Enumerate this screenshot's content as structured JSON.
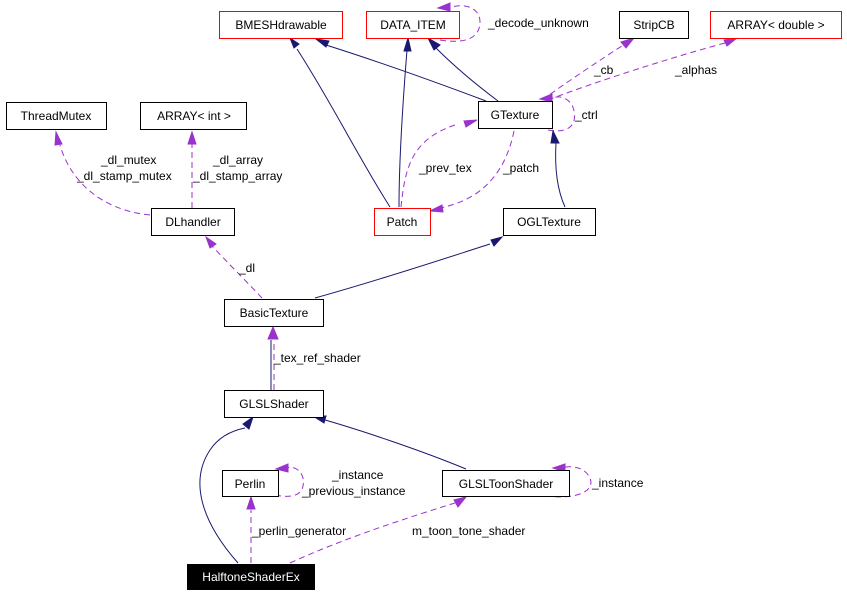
{
  "diagram": {
    "type": "doxygen-collaboration-graph",
    "focus_node": "HalftoneShaderEx",
    "colors": {
      "inheritance_edge": "#191970",
      "usage_edge": "#9a32cd",
      "undocumented_border": "#ff0000",
      "documented_border": "#000000",
      "focus_fill": "#000000"
    },
    "nodes": [
      {
        "id": "bmeshdrawable",
        "label": "BMESHdrawable",
        "style": "red"
      },
      {
        "id": "data_item",
        "label": "DATA_ITEM",
        "style": "red"
      },
      {
        "id": "stripcb",
        "label": "StripCB",
        "style": "normal"
      },
      {
        "id": "array_double",
        "label": "ARRAY< double >",
        "style": "red"
      },
      {
        "id": "threadmutex",
        "label": "ThreadMutex",
        "style": "normal"
      },
      {
        "id": "array_int",
        "label": "ARRAY< int >",
        "style": "normal"
      },
      {
        "id": "gtexture",
        "label": "GTexture",
        "style": "normal"
      },
      {
        "id": "dlhandler",
        "label": "DLhandler",
        "style": "normal"
      },
      {
        "id": "patch",
        "label": "Patch",
        "style": "red"
      },
      {
        "id": "ogltexture",
        "label": "OGLTexture",
        "style": "normal"
      },
      {
        "id": "basictexture",
        "label": "BasicTexture",
        "style": "normal"
      },
      {
        "id": "glslshader",
        "label": "GLSLShader",
        "style": "normal"
      },
      {
        "id": "perlin",
        "label": "Perlin",
        "style": "normal"
      },
      {
        "id": "glsltoonshader",
        "label": "GLSLToonShader",
        "style": "normal"
      },
      {
        "id": "halftoneshaderex",
        "label": "HalftoneShaderEx",
        "style": "focus"
      }
    ],
    "edges": [
      {
        "from": "patch",
        "to": "bmeshdrawable",
        "kind": "inherit",
        "label": ""
      },
      {
        "from": "gtexture",
        "to": "bmeshdrawable",
        "kind": "inherit",
        "label": ""
      },
      {
        "from": "patch",
        "to": "data_item",
        "kind": "inherit",
        "label": ""
      },
      {
        "from": "gtexture",
        "to": "data_item",
        "kind": "inherit",
        "label": ""
      },
      {
        "from": "data_item",
        "to": "data_item",
        "kind": "usage",
        "label": "_decode_unknown"
      },
      {
        "from": "gtexture",
        "to": "stripcb",
        "kind": "usage",
        "label": "_cb"
      },
      {
        "from": "gtexture",
        "to": "array_double",
        "kind": "usage",
        "label": "_alphas"
      },
      {
        "from": "gtexture",
        "to": "gtexture",
        "kind": "usage",
        "label": "_ctrl"
      },
      {
        "from": "patch",
        "to": "gtexture",
        "kind": "usage",
        "label": "_prev_tex"
      },
      {
        "from": "gtexture",
        "to": "patch",
        "kind": "usage",
        "label": "_patch"
      },
      {
        "from": "dlhandler",
        "to": "threadmutex",
        "kind": "usage",
        "label": "_dl_mutex\n_dl_stamp_mutex"
      },
      {
        "from": "dlhandler",
        "to": "array_int",
        "kind": "usage",
        "label": "_dl_array\n_dl_stamp_array"
      },
      {
        "from": "ogltexture",
        "to": "gtexture",
        "kind": "inherit",
        "label": ""
      },
      {
        "from": "basictexture",
        "to": "dlhandler",
        "kind": "usage",
        "label": "_dl"
      },
      {
        "from": "basictexture",
        "to": "ogltexture",
        "kind": "inherit",
        "label": ""
      },
      {
        "from": "glslshader",
        "to": "basictexture",
        "kind": "usage",
        "label": "_tex_ref_shader"
      },
      {
        "from": "glslshader",
        "to": "basictexture",
        "kind": "inherit",
        "label": ""
      },
      {
        "from": "glsltoonshader",
        "to": "glslshader",
        "kind": "inherit",
        "label": ""
      },
      {
        "from": "halftoneshaderex",
        "to": "glslshader",
        "kind": "inherit",
        "label": ""
      },
      {
        "from": "perlin",
        "to": "perlin",
        "kind": "usage",
        "label": "_instance\n_previous_instance"
      },
      {
        "from": "glsltoonshader",
        "to": "glsltoonshader",
        "kind": "usage",
        "label": "_instance"
      },
      {
        "from": "halftoneshaderex",
        "to": "perlin",
        "kind": "usage",
        "label": "_perlin_generator"
      },
      {
        "from": "halftoneshaderex",
        "to": "glsltoonshader",
        "kind": "usage",
        "label": "m_toon_tone_shader"
      }
    ]
  },
  "labels": {
    "decode_unknown": "_decode_unknown",
    "cb": "_cb",
    "alphas": "_alphas",
    "ctrl": "_ctrl",
    "prev_tex": "_prev_tex",
    "patch": "_patch",
    "dl_mutex": "_dl_mutex",
    "dl_stamp_mutex": "_dl_stamp_mutex",
    "dl_array": "_dl_array",
    "dl_stamp_array": "_dl_stamp_array",
    "dl": "_dl",
    "tex_ref_shader": "_tex_ref_shader",
    "perlin_instance": "_instance",
    "previous_instance": "_previous_instance",
    "toon_instance": "_instance",
    "perlin_generator": "_perlin_generator",
    "m_toon_tone_shader": "m_toon_tone_shader"
  }
}
